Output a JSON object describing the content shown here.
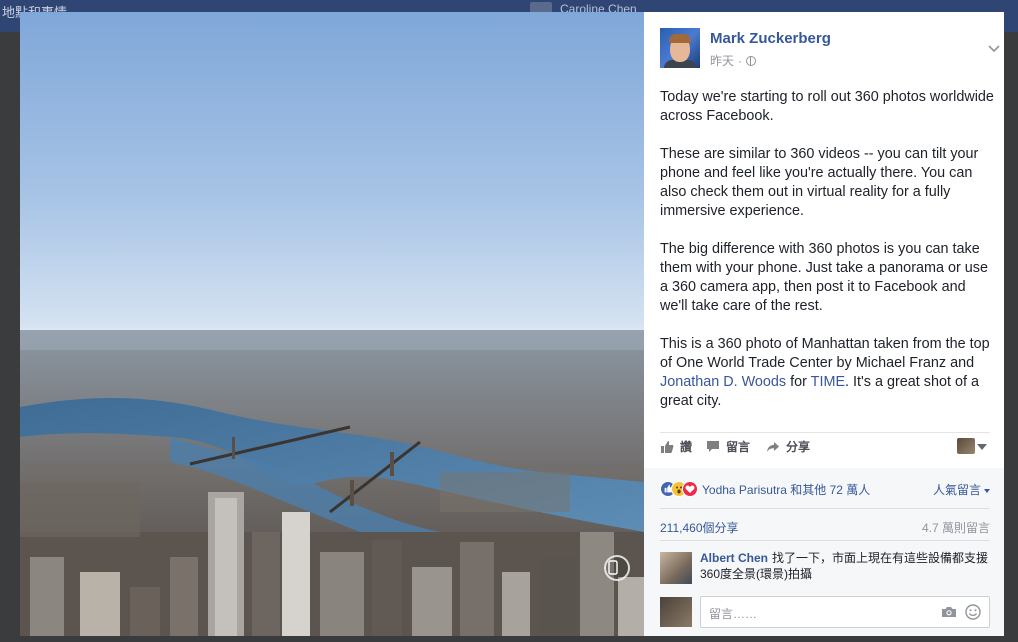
{
  "background": {
    "title": "地點和事情",
    "user_name": "Caroline Chen"
  },
  "photo": {
    "pano_icon": "360-view-icon"
  },
  "post": {
    "author": "Mark Zuckerberg",
    "time": "昨天",
    "separator": "·",
    "paragraphs": {
      "p1": "Today we're starting to roll out 360 photos worldwide across Facebook.",
      "p2": "These are similar to 360 videos -- you can tilt your phone and feel like you're actually there. You can also check them out in virtual reality for a fully immersive experience.",
      "p3": "The big difference with 360 photos is you can take them with your phone. Just take a panorama or use a 360 camera app, then post it to Facebook and we'll take care of the rest.",
      "p4_a": "This is a 360 photo of Manhattan taken from the top of One World Trade Center by Michael Franz and ",
      "p4_link1": "Jonathan D. Woods",
      "p4_b": " for ",
      "p4_link2": "TIME",
      "p4_c": ". It's a great shot of a great city."
    }
  },
  "actions": {
    "like": "讚",
    "comment": "留言",
    "share": "分享"
  },
  "reactions": {
    "names": "Yodha Parisutra 和其他 72 萬人",
    "top_comments": "人氣留言"
  },
  "stats": {
    "shares": "211,460個分享",
    "comments": "4.7 萬則留言"
  },
  "comment": {
    "author": "Albert Chen",
    "text": "找了一下，市面上現在有這些設備都支援360度全景(環景)拍攝"
  },
  "composer": {
    "placeholder": "留言……"
  },
  "colors": {
    "link": "#365899",
    "like_blue": "#4267b2",
    "love_red": "#f0284a",
    "wow_yellow": "#f7c23a"
  }
}
